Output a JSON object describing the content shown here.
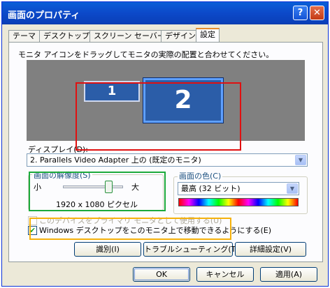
{
  "window": {
    "title": "画面のプロパティ",
    "help_label": "?",
    "close_label": "✕"
  },
  "tabs": [
    "テーマ",
    "デスクトップ",
    "スクリーン セーバー",
    "デザイン",
    "設定"
  ],
  "active_tab": "設定",
  "settings": {
    "instruction": "モニタ アイコンをドラッグしてモニタの実際の配置と合わせてください。",
    "monitor1": "1",
    "monitor2": "2",
    "display_label": "ディスプレイ(D):",
    "display_value": "2. Parallels Video Adapter 上の (既定のモニタ)",
    "resolution": {
      "title": "画面の解像度(S)",
      "small": "小",
      "large": "大",
      "value": "1920 x 1080 ピクセル"
    },
    "color": {
      "title": "画面の色(C)",
      "value": "最高 (32 ビット)"
    },
    "primary_checkbox": {
      "label": "このデバイスをプライマリ モニタとして使用する(U)",
      "checked": false,
      "enabled": false
    },
    "extend_checkbox": {
      "label": "Windows デスクトップをこのモニタ上で移動できるようにする(E)",
      "checked": true
    },
    "buttons": {
      "identify": "識別(I)",
      "troubleshoot": "トラブルシューティング(T)...",
      "advanced": "詳細設定(V)"
    }
  },
  "footer": {
    "ok": "OK",
    "cancel": "キャンセル",
    "apply": "適用(A)"
  },
  "colors": {
    "highlight_red": "#e01010",
    "highlight_green": "#1caa3c",
    "highlight_orange": "#f5b10b"
  }
}
